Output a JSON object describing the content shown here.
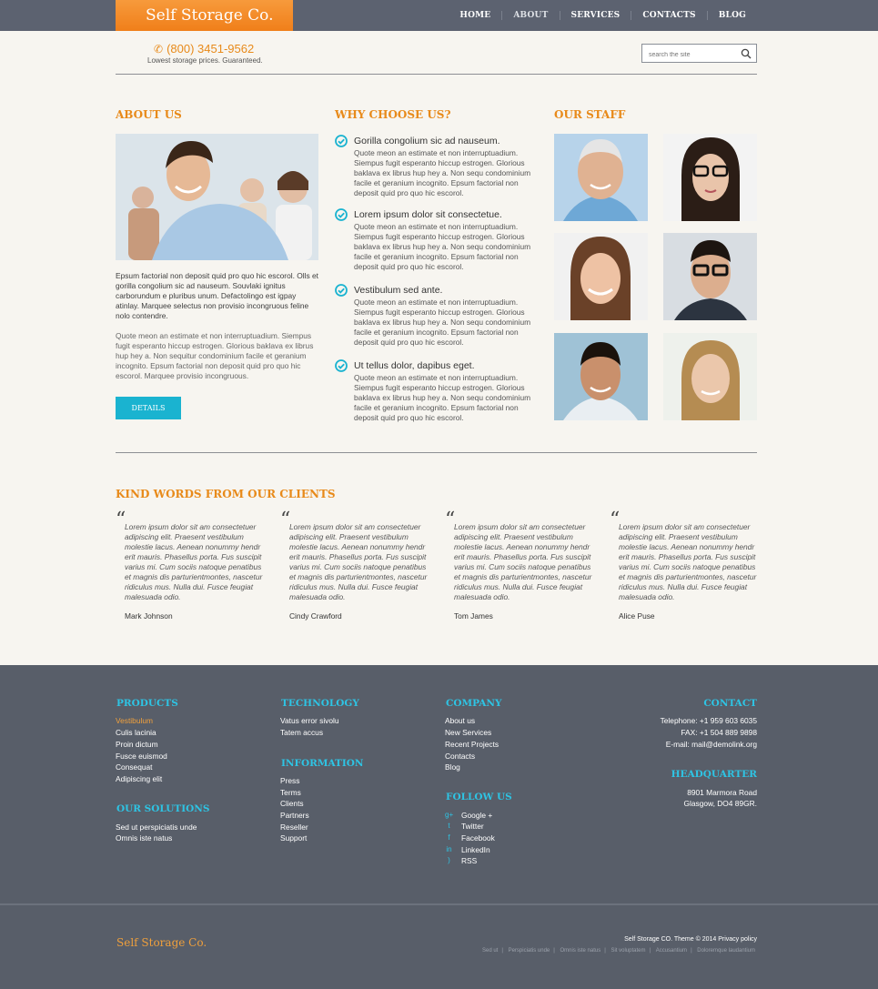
{
  "brand": "Self Storage Co.",
  "nav": [
    "HOME",
    "ABOUT",
    "SERVICES",
    "CONTACTS",
    "BLOG"
  ],
  "header": {
    "phone": "(800) 3451-9562",
    "tagline": "Lowest storage prices. Guaranteed.",
    "search_placeholder": "search the site"
  },
  "about": {
    "heading": "ABOUT US",
    "p1": "Epsum factorial non deposit quid pro quo hic escorol. Olls et gorilla congolium sic ad nauseum. Souvlaki ignitus carborundum e pluribus unum. Defactolingo est igpay atinlay. Marquee selectus non provisio incongruous feline nolo contendre.",
    "p2": "Quote meon an estimate et non interruptuadium. Siempus fugit esperanto hiccup estrogen. Glorious baklava ex librus hup hey a. Non sequitur condominium facile et geranium incognito. Epsum factorial non deposit quid pro quo hic escorol. Marquee provisio incongruous.",
    "button": "DETAILS"
  },
  "why": {
    "heading": "WHY CHOOSE US?",
    "items": [
      {
        "title": "Gorilla congolium sic ad nauseum.",
        "body": "Quote meon an estimate et non interruptuadium. Siempus fugit esperanto hiccup estrogen. Glorious baklava ex librus hup hey a. Non sequ condominium facile et geranium incognito. Epsum factorial non deposit quid pro quo hic escorol."
      },
      {
        "title": "Lorem ipsum dolor sit consectetue.",
        "body": "Quote meon an estimate et non interruptuadium. Siempus fugit esperanto hiccup estrogen. Glorious baklava ex librus hup hey a. Non sequ condominium facile et geranium incognito. Epsum factorial non deposit quid pro quo hic escorol."
      },
      {
        "title": "Vestibulum sed ante.",
        "body": "Quote meon an estimate et non interruptuadium. Siempus fugit esperanto hiccup estrogen. Glorious baklava ex librus hup hey a. Non sequ condominium facile et geranium incognito. Epsum factorial non deposit quid pro quo hic escorol."
      },
      {
        "title": "Ut tellus dolor, dapibus eget.",
        "body": "Quote meon an estimate et non interruptuadium. Siempus fugit esperanto hiccup estrogen. Glorious baklava ex librus hup hey a. Non sequ condominium facile et geranium incognito. Epsum factorial non deposit quid pro quo hic escorol."
      }
    ]
  },
  "staff": {
    "heading": "OUR STAFF"
  },
  "testimonials": {
    "heading": "KIND WORDS FROM OUR CLIENTS",
    "items": [
      {
        "text": "Lorem ipsum dolor sit am consectetuer adipiscing elit. Praesent vestibulum molestie lacus. Aenean nonummy hendr erit mauris. Phasellus porta. Fus suscipit varius mi. Cum sociis natoque penatibus et magnis dis parturientmontes, nascetur ridiculus mus. Nulla dui. Fusce feugiat malesuada odio.",
        "author": "Mark Johnson"
      },
      {
        "text": "Lorem ipsum dolor sit am consectetuer adipiscing elit. Praesent vestibulum molestie lacus. Aenean nonummy hendr erit mauris. Phasellus porta. Fus suscipit varius mi. Cum sociis natoque penatibus et magnis dis parturientmontes, nascetur ridiculus mus. Nulla dui. Fusce feugiat malesuada odio.",
        "author": "Cindy Crawford"
      },
      {
        "text": "Lorem ipsum dolor sit am consectetuer adipiscing elit. Praesent vestibulum molestie lacus. Aenean nonummy hendr erit mauris. Phasellus porta. Fus suscipit varius mi. Cum sociis natoque penatibus et magnis dis parturientmontes, nascetur ridiculus mus. Nulla dui. Fusce feugiat malesuada odio.",
        "author": "Tom James"
      },
      {
        "text": "Lorem ipsum dolor sit am consectetuer adipiscing elit. Praesent vestibulum molestie lacus. Aenean nonummy hendr erit mauris. Phasellus porta. Fus suscipit varius mi. Cum sociis natoque penatibus et magnis dis parturientmontes, nascetur ridiculus mus. Nulla dui. Fusce feugiat malesuada odio.",
        "author": "Alice Puse"
      }
    ]
  },
  "footer": {
    "products": {
      "heading": "PRODUCTS",
      "links": [
        "Vestibulum",
        "Culis lacinia",
        "Proin dictum",
        "Fusce euismod",
        "Consequat",
        "Adipiscing elit"
      ]
    },
    "solutions": {
      "heading": "OUR SOLUTIONS",
      "links": [
        "Sed ut perspiciatis unde",
        "Omnis iste natus"
      ]
    },
    "technology": {
      "heading": "TECHNOLOGY",
      "links": [
        "Vatus error sivolu",
        "Tatem accus"
      ]
    },
    "information": {
      "heading": "INFORMATION",
      "links": [
        "Press",
        "Terms",
        "Clients",
        "Partners",
        "Reseller",
        "Support"
      ]
    },
    "company": {
      "heading": "COMPANY",
      "links": [
        "About us",
        "New Services",
        "Recent Projects",
        "Contacts",
        "Blog"
      ]
    },
    "follow": {
      "heading": "FOLLOW US",
      "links": [
        {
          "label": "Google +",
          "icon": "google-plus-icon"
        },
        {
          "label": "Twitter",
          "icon": "twitter-icon"
        },
        {
          "label": "Facebook",
          "icon": "facebook-icon"
        },
        {
          "label": "LinkedIn",
          "icon": "linkedin-icon"
        },
        {
          "label": "RSS",
          "icon": "rss-icon"
        }
      ]
    },
    "contact": {
      "heading": "CONTACT",
      "lines": [
        "Telephone:   +1 959 603 6035",
        "FAX:          +1 504 889 9898",
        "E-mail: mail@demolink.org"
      ]
    },
    "headquarter": {
      "heading": "HEADQUARTER",
      "lines": [
        "8901 Marmora Road",
        "Glasgow, DO4 89GR."
      ]
    },
    "logo": "Self Storage Co.",
    "copyright": "Self Storage CO. Theme © 2014 Privacy policy",
    "sublinks": [
      "Sed ut",
      "Perspiciatis unde",
      "Omnis iste natus",
      "Sit voluptatem",
      "Accusantium",
      "Doloremque laudantium"
    ]
  },
  "colors": {
    "accent": "#e88a1a",
    "button": "#1ab3d0",
    "footer": "#585e69",
    "footer_heading": "#2ec4e4"
  }
}
